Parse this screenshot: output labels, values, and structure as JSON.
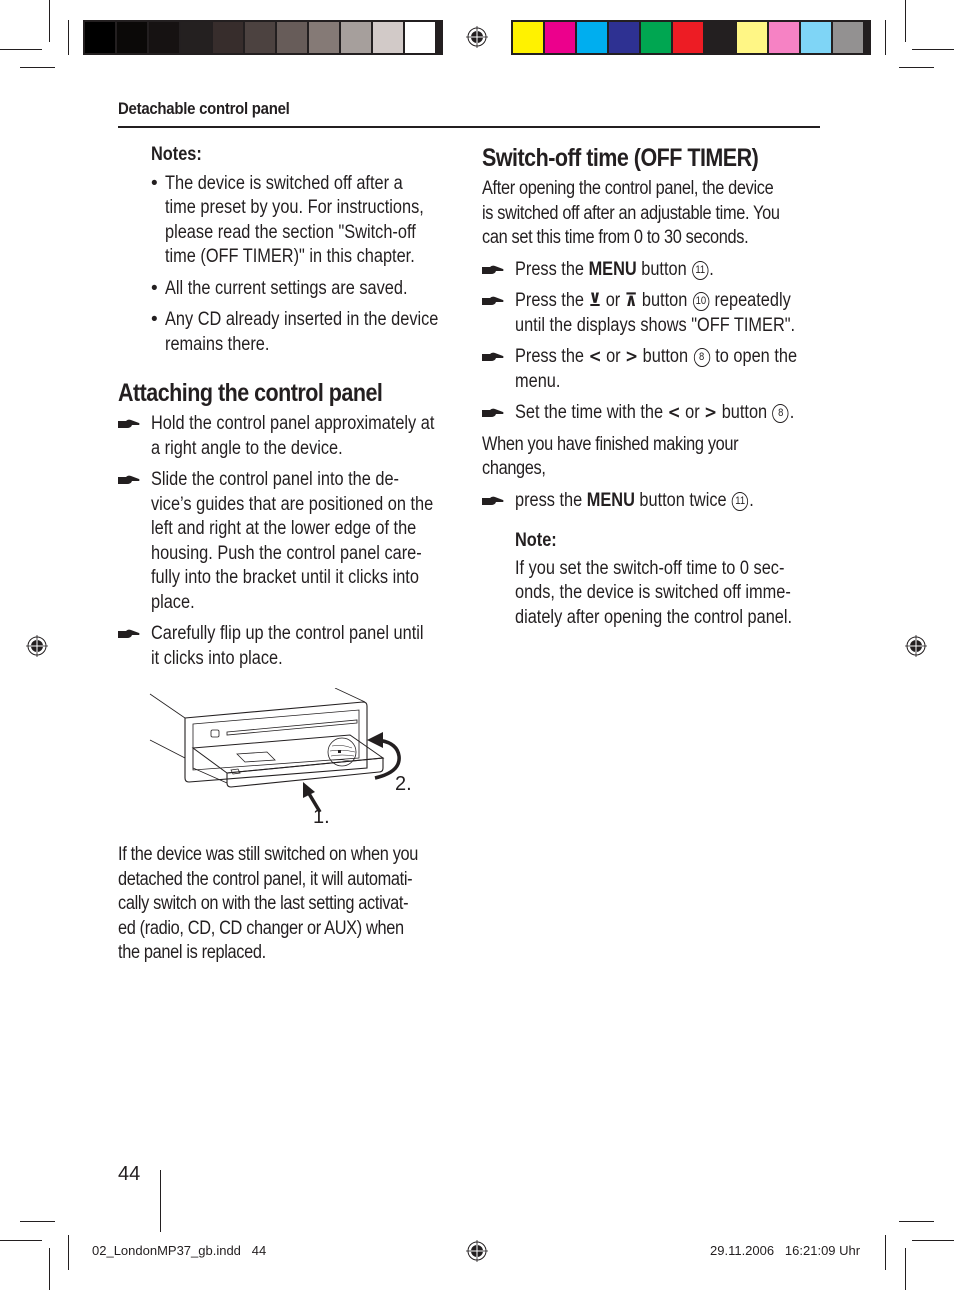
{
  "print_marks": {
    "grayscale_swatches": [
      "#000000",
      "#0b0908",
      "#161212",
      "#242020",
      "#372d2c",
      "#4c4240",
      "#675c59",
      "#857a76",
      "#a69f9c",
      "#d2cac8",
      "#ffffff"
    ],
    "color_swatches": [
      "#fff200",
      "#ec008c",
      "#00aeef",
      "#2e3192",
      "#00a651",
      "#ed1c24",
      "#231f20",
      "#fff685",
      "#f682c4",
      "#7fd5f6",
      "#939191"
    ]
  },
  "header": {
    "running_head": "Detachable control panel"
  },
  "left_column": {
    "notes": {
      "title": "Notes:",
      "items": [
        [
          "The device is switched off after a",
          "time preset by you. For instructions,",
          "please read the section \"Switch-off",
          "time (OFF TIMER)\" in this chapter."
        ],
        [
          "All the current settings are saved."
        ],
        [
          "Any CD already inserted in the device",
          "remains there."
        ]
      ]
    },
    "attaching": {
      "heading": "Attaching the control panel",
      "steps": [
        [
          "Hold the control panel approximately at",
          "a right angle to the device."
        ],
        [
          "Slide the control panel into the de-",
          "vice’s guides that are positioned on the",
          "left and right at the lower edge of the",
          "housing. Push the control panel care-",
          "fully into the bracket until it clicks into",
          "place."
        ],
        [
          "Carefully flip up the control panel until",
          "it clicks into place."
        ]
      ]
    },
    "figure": {
      "label_1": "1.",
      "label_2": "2."
    },
    "after_paragraph": [
      "If the device was still switched on when you",
      "detached the control panel, it will automati-",
      "cally switch on with the last setting activat-",
      "ed (radio, CD, CD changer or AUX) when",
      "the panel is replaced."
    ]
  },
  "right_column": {
    "heading": "Switch-off time (OFF TIMER)",
    "intro": [
      "After opening the control panel, the device",
      "is switched off after an adjustable time. You",
      "can set this time from 0 to 30 seconds."
    ],
    "steps": {
      "s1": {
        "pre": "Press the ",
        "bold": "MENU",
        "post": " button ",
        "num": "11",
        "end": "."
      },
      "s2": {
        "pre": "Press the ",
        "sym1": "⊻",
        "or": " or ",
        "sym2": "⊼",
        "post": " button ",
        "num": "10",
        "end": " repeatedly",
        "line2": "until the displays shows \"OFF TIMER\"."
      },
      "s3": {
        "pre": "Press the ",
        "sym1": "<",
        "or": " or ",
        "sym2": ">",
        "post": " button ",
        "num": "8",
        "end": " to open the",
        "line2": "menu."
      },
      "s4": {
        "pre": "Set the time with the ",
        "sym1": "<",
        "or": " or ",
        "sym2": ">",
        "post": " button ",
        "num": "8",
        "end": "."
      }
    },
    "when_finished": [
      "When you have finished making your",
      "changes,"
    ],
    "final_step": {
      "pre": "press the ",
      "bold": "MENU",
      "post": " button twice ",
      "num": "11",
      "end": "."
    },
    "note": {
      "title": "Note:",
      "lines": [
        "If you set the switch-off time to 0 sec-",
        "onds, the device is switched off imme-",
        "diately after opening the control panel."
      ]
    }
  },
  "footer": {
    "page_number": "44",
    "file_slug": "02_LondonMP37_gb.indd   44",
    "timestamp": "29.11.2006   16:21:09 Uhr"
  }
}
